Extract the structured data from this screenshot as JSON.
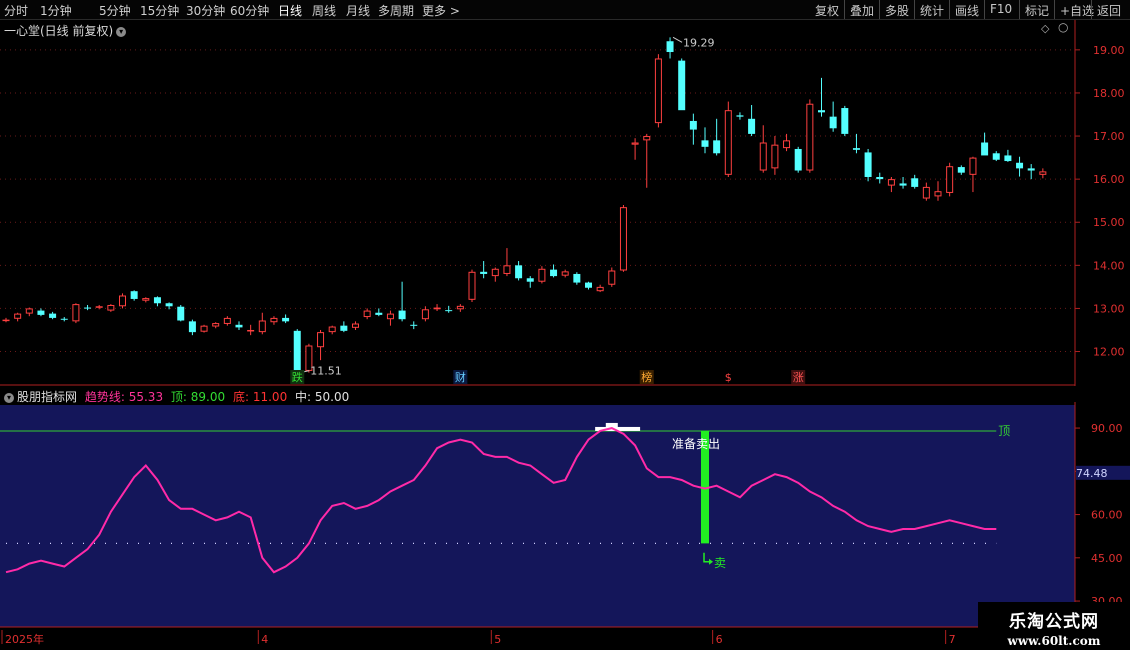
{
  "toolbar": {
    "left_items": [
      "分时",
      "1分钟",
      "5分钟",
      "15分钟",
      "30分钟",
      "60分钟",
      "日线",
      "周线",
      "月线",
      "多周期",
      "更多"
    ],
    "active_item": "日线",
    "right_items": [
      "复权",
      "叠加",
      "多股",
      "统计",
      "画线",
      "F10",
      "标记",
      "+自选",
      "返回"
    ]
  },
  "main_panel": {
    "title": "一心堂(日线 前复权)",
    "high_label": "19.29",
    "low_label": "11.51",
    "event_markers": [
      {
        "text": "跌",
        "color": "#33dd33",
        "bg": "#103010"
      },
      {
        "text": "财",
        "color": "#66ccff",
        "bg": "#0a1a40"
      },
      {
        "text": "榜",
        "color": "#ffaa33",
        "bg": "#3a2000"
      },
      {
        "text": "$",
        "color": "#ff4444",
        "bg": ""
      },
      {
        "text": "涨",
        "color": "#ff5555",
        "bg": "#401010"
      }
    ]
  },
  "indicator_panel": {
    "name": "股朋指标网",
    "legend": [
      {
        "key": "趋势线",
        "value": "55.33",
        "color": "#ff3399"
      },
      {
        "key": "顶",
        "value": "89.00",
        "color": "#33dd33"
      },
      {
        "key": "底",
        "value": "11.00",
        "color": "#ff3333"
      },
      {
        "key": "中",
        "value": "50.00",
        "color": "#e0e0e0"
      }
    ],
    "top_label": "顶",
    "annotation_prepare": "准备卖出",
    "annotation_sell": "卖",
    "current_value_tag": "74.48",
    "colors": {
      "background": "#14165a",
      "trend": "#ff2aa8",
      "top_line": "#33cc33",
      "signal_bar": "#22ee22"
    }
  },
  "date_axis": {
    "labels": [
      {
        "text": "2025年",
        "index": 0
      },
      {
        "text": "4",
        "index": 22
      },
      {
        "text": "5",
        "index": 42
      },
      {
        "text": "6",
        "index": 61
      },
      {
        "text": "7",
        "index": 81
      }
    ]
  },
  "watermark": {
    "line1": "乐淘公式网",
    "line2": "www.60lt.com"
  },
  "chart_data": [
    {
      "type": "candlestick",
      "ylim": [
        11.2,
        19.6
      ],
      "yticks": [
        "12.00",
        "13.00",
        "14.00",
        "15.00",
        "16.00",
        "17.00",
        "18.00",
        "19.00"
      ],
      "up_color": "#ff4040",
      "down_color": "#54ffff",
      "ohlc": [
        [
          12.72,
          12.78,
          12.68,
          12.74
        ],
        [
          12.76,
          12.9,
          12.7,
          12.88
        ],
        [
          12.88,
          13.02,
          12.82,
          13.0
        ],
        [
          12.95,
          13.0,
          12.82,
          12.85
        ],
        [
          12.88,
          12.92,
          12.75,
          12.78
        ],
        [
          12.76,
          12.8,
          12.7,
          12.75
        ],
        [
          12.7,
          13.12,
          12.66,
          13.1
        ],
        [
          13.02,
          13.08,
          12.96,
          13.0
        ],
        [
          13.02,
          13.08,
          12.98,
          13.05
        ],
        [
          12.95,
          13.1,
          12.92,
          13.08
        ],
        [
          13.05,
          13.35,
          13.0,
          13.3
        ],
        [
          13.4,
          13.42,
          13.18,
          13.22
        ],
        [
          13.18,
          13.26,
          13.14,
          13.24
        ],
        [
          13.26,
          13.28,
          13.05,
          13.12
        ],
        [
          13.12,
          13.14,
          12.98,
          13.05
        ],
        [
          13.04,
          13.08,
          12.7,
          12.72
        ],
        [
          12.7,
          12.74,
          12.38,
          12.45
        ],
        [
          12.46,
          12.62,
          12.44,
          12.6
        ],
        [
          12.58,
          12.68,
          12.54,
          12.66
        ],
        [
          12.64,
          12.82,
          12.6,
          12.78
        ],
        [
          12.62,
          12.7,
          12.5,
          12.56
        ],
        [
          12.48,
          12.62,
          12.38,
          12.5
        ],
        [
          12.45,
          12.9,
          12.4,
          12.72
        ],
        [
          12.68,
          12.82,
          12.62,
          12.78
        ],
        [
          12.78,
          12.86,
          12.66,
          12.7
        ],
        [
          12.48,
          12.52,
          11.51,
          11.55
        ],
        [
          11.55,
          12.18,
          11.51,
          12.14
        ],
        [
          12.1,
          12.5,
          11.8,
          12.45
        ],
        [
          12.45,
          12.6,
          12.4,
          12.58
        ],
        [
          12.6,
          12.7,
          12.45,
          12.48
        ],
        [
          12.55,
          12.7,
          12.5,
          12.65
        ],
        [
          12.8,
          13.0,
          12.75,
          12.95
        ],
        [
          12.9,
          13.0,
          12.82,
          12.85
        ],
        [
          12.75,
          12.95,
          12.6,
          12.88
        ],
        [
          12.95,
          13.62,
          12.7,
          12.75
        ],
        [
          12.62,
          12.7,
          12.52,
          12.6
        ],
        [
          12.75,
          13.05,
          12.7,
          12.98
        ],
        [
          12.98,
          13.1,
          12.94,
          13.02
        ],
        [
          12.96,
          13.06,
          12.9,
          12.94
        ],
        [
          12.98,
          13.1,
          12.92,
          13.06
        ],
        [
          13.2,
          13.9,
          13.15,
          13.85
        ],
        [
          13.85,
          14.1,
          13.7,
          13.8
        ],
        [
          13.75,
          13.95,
          13.62,
          13.92
        ],
        [
          13.8,
          14.4,
          13.75,
          14.0
        ],
        [
          14.0,
          14.1,
          13.65,
          13.7
        ],
        [
          13.7,
          13.75,
          13.48,
          13.62
        ],
        [
          13.62,
          13.98,
          13.58,
          13.92
        ],
        [
          13.9,
          14.02,
          13.72,
          13.75
        ],
        [
          13.76,
          13.9,
          13.72,
          13.86
        ],
        [
          13.8,
          13.84,
          13.55,
          13.6
        ],
        [
          13.6,
          13.62,
          13.44,
          13.48
        ],
        [
          13.4,
          13.55,
          13.38,
          13.5
        ],
        [
          13.55,
          13.95,
          13.5,
          13.88
        ],
        [
          13.88,
          15.4,
          13.85,
          15.35
        ],
        [
          16.8,
          16.95,
          16.45,
          16.85
        ],
        [
          16.9,
          17.05,
          15.8,
          17.0
        ],
        [
          17.3,
          18.9,
          17.2,
          18.8
        ],
        [
          19.2,
          19.29,
          18.8,
          18.95
        ],
        [
          18.75,
          18.8,
          17.7,
          17.6
        ],
        [
          17.35,
          17.52,
          16.8,
          17.15
        ],
        [
          16.9,
          17.2,
          16.6,
          16.75
        ],
        [
          16.9,
          17.4,
          16.55,
          16.6
        ],
        [
          16.1,
          17.8,
          16.05,
          17.6
        ],
        [
          17.48,
          17.55,
          17.38,
          17.45
        ],
        [
          17.4,
          17.72,
          17.0,
          17.05
        ],
        [
          16.2,
          17.25,
          16.15,
          16.85
        ],
        [
          16.25,
          17.0,
          16.1,
          16.8
        ],
        [
          16.72,
          17.05,
          16.65,
          16.9
        ],
        [
          16.7,
          16.75,
          16.15,
          16.2
        ],
        [
          16.2,
          17.85,
          16.15,
          17.75
        ],
        [
          17.6,
          18.35,
          17.45,
          17.55
        ],
        [
          17.45,
          17.8,
          17.1,
          17.18
        ],
        [
          17.65,
          17.7,
          17.0,
          17.05
        ],
        [
          16.72,
          17.05,
          16.6,
          16.68
        ],
        [
          16.62,
          16.7,
          15.95,
          16.05
        ],
        [
          16.05,
          16.15,
          15.9,
          16.0
        ],
        [
          15.85,
          16.05,
          15.7,
          16.0
        ],
        [
          15.9,
          16.05,
          15.78,
          15.85
        ],
        [
          16.02,
          16.1,
          15.78,
          15.82
        ],
        [
          15.55,
          15.92,
          15.5,
          15.82
        ],
        [
          15.6,
          15.95,
          15.5,
          15.72
        ],
        [
          15.68,
          16.38,
          15.6,
          16.3
        ],
        [
          16.28,
          16.32,
          16.1,
          16.15
        ],
        [
          16.1,
          16.52,
          15.7,
          16.5
        ],
        [
          16.85,
          17.08,
          16.6,
          16.55
        ],
        [
          16.6,
          16.65,
          16.42,
          16.45
        ],
        [
          16.55,
          16.68,
          16.4,
          16.42
        ],
        [
          16.38,
          16.52,
          16.06,
          16.25
        ],
        [
          16.25,
          16.35,
          16.0,
          16.2
        ],
        [
          16.1,
          16.25,
          16.02,
          16.18
        ]
      ]
    },
    {
      "type": "line",
      "ylim": [
        21,
        98
      ],
      "yticks": [
        "90.00",
        "75.00",
        "60.00",
        "45.00",
        "30.00"
      ],
      "series": [
        {
          "name": "趋势线",
          "values": [
            40,
            41,
            43,
            44,
            43,
            42,
            45,
            48,
            53,
            61,
            67,
            73,
            77,
            72,
            65,
            62,
            62,
            60,
            58,
            59,
            61,
            59,
            45,
            40,
            42,
            45,
            50,
            58,
            63,
            64,
            62,
            63,
            65,
            68,
            70,
            72,
            77,
            83,
            85,
            86,
            85,
            81,
            80,
            80,
            78,
            77,
            74,
            71,
            72,
            80,
            86,
            89,
            90,
            88,
            84,
            76,
            73,
            73,
            72,
            70,
            69,
            70,
            68,
            66,
            70,
            72,
            74,
            73,
            71,
            68,
            66,
            63,
            61,
            58,
            56,
            55,
            54,
            55,
            55,
            56,
            57,
            58,
            57,
            56,
            55,
            55
          ]
        },
        {
          "name": "顶",
          "values": [
            89
          ]
        },
        {
          "name": "中",
          "values": [
            50
          ]
        }
      ],
      "signal_bar": {
        "index": 60,
        "from": 50,
        "to": 89
      }
    }
  ]
}
